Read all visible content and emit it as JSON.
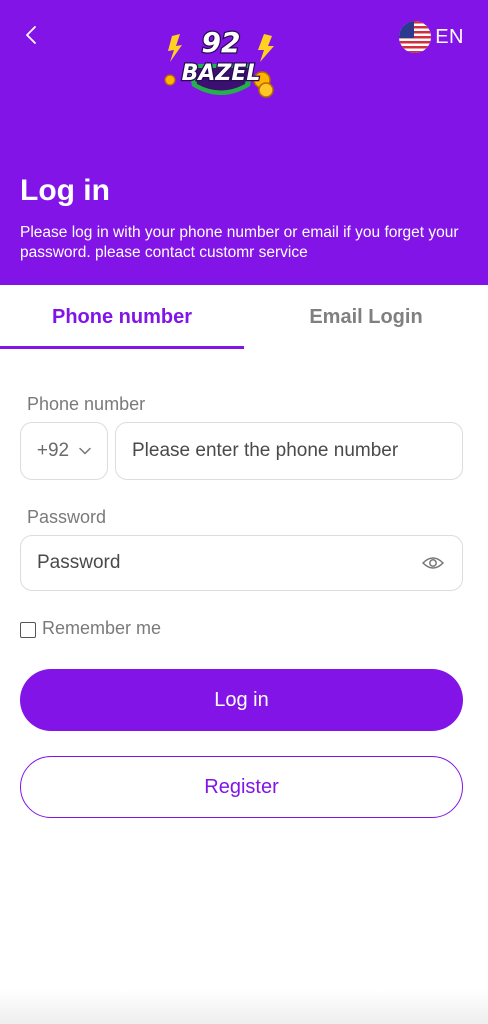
{
  "header": {
    "logo_text_top": "92",
    "logo_text_bottom": "BAZEL",
    "language_code": "EN",
    "title": "Log in",
    "description": "Please log in with your phone number or email if you forget your password. please contact customr service"
  },
  "tabs": [
    {
      "label": "Phone number",
      "active": true
    },
    {
      "label": "Email Login",
      "active": false
    }
  ],
  "form": {
    "phone_label": "Phone number",
    "country_code": "+92",
    "phone_placeholder": "Please enter the phone number",
    "password_label": "Password",
    "password_placeholder": "Password",
    "remember_label": "Remember me",
    "remember_checked": false
  },
  "buttons": {
    "login_label": "Log in",
    "register_label": "Register"
  },
  "icons": {
    "back": "chevron-left-icon",
    "flag": "us-flag-icon",
    "dropdown": "chevron-down-icon",
    "password_toggle": "eye-icon"
  },
  "colors": {
    "brand": "#8214e8",
    "white": "#ffffff",
    "muted_text": "#7a7a7a",
    "border": "#dcdcdc"
  }
}
